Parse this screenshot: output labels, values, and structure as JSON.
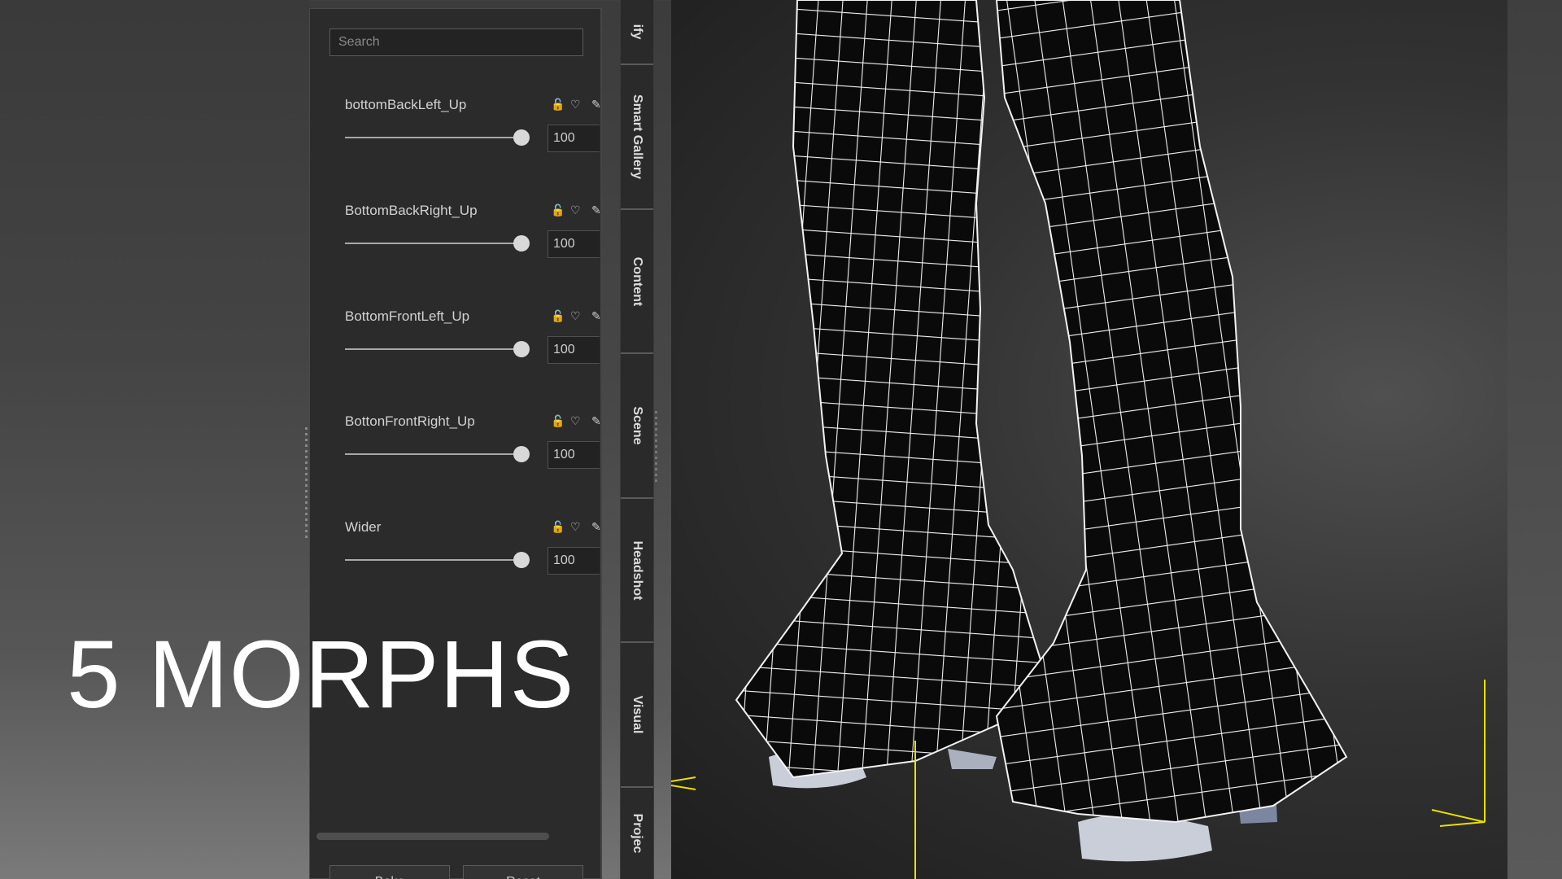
{
  "overlay": {
    "caption": "5 MORPHS"
  },
  "panel": {
    "search": {
      "placeholder": "Search",
      "value": ""
    },
    "morphs": [
      {
        "label": "bottomBackLeft_Up",
        "value": "100"
      },
      {
        "label": "BottomBackRight_Up",
        "value": "100"
      },
      {
        "label": "BottomFrontLeft_Up",
        "value": "100"
      },
      {
        "label": "BottonFrontRight_Up",
        "value": "100"
      },
      {
        "label": "Wider",
        "value": "100"
      }
    ],
    "buttons": {
      "bake": "Bake",
      "reset": "Reset"
    }
  },
  "tabs": [
    "ify",
    "Smart Gallery",
    "Content",
    "Scene",
    "Headshot",
    "Visual",
    "Projec"
  ],
  "icons": {
    "lock": "lock-icon",
    "favorite": "heart-icon",
    "edit": "pencil-icon"
  }
}
